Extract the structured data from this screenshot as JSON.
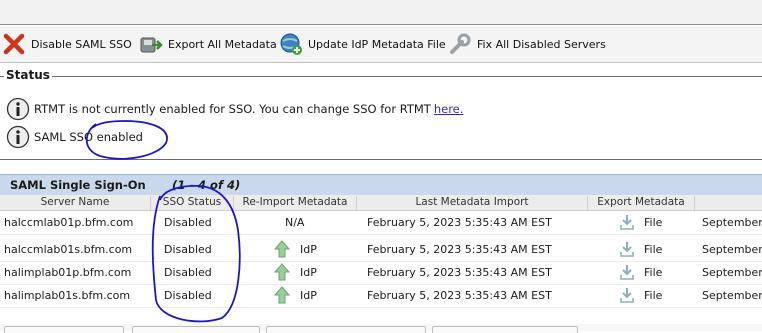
{
  "toolbar": {
    "disable_sso": "Disable SAML SSO",
    "export_all": "Export All Metadata",
    "update_idp": "Update IdP Metadata File",
    "fix_servers": "Fix All Disabled Servers"
  },
  "status": {
    "legend": "Status",
    "rtmt_message": "RTMT is not currently enabled for SSO. You can change SSO for RTMT",
    "rtmt_link": "here.",
    "saml_message": "SAML SSO enabled"
  },
  "grid": {
    "title": "SAML Single Sign-On",
    "count": "(1 - 4 of 4)",
    "columns": [
      "Server Name",
      "SSO Status",
      "Re-Import Metadata",
      "Last Metadata Import",
      "Export Metadata"
    ],
    "rows": [
      {
        "server": "halccmlab01p.bfm.com",
        "status": "Disabled",
        "reimport": "N/A",
        "last_import": "February 5, 2023 5:35:43 AM EST",
        "export": "File",
        "extra": "September"
      },
      {
        "server": "halccmlab01s.bfm.com",
        "status": "Disabled",
        "reimport": "IdP",
        "last_import": "February 5, 2023 5:35:43 AM EST",
        "export": "File",
        "extra": "September"
      },
      {
        "server": "halimplab01p.bfm.com",
        "status": "Disabled",
        "reimport": "IdP",
        "last_import": "February 5, 2023 5:35:43 AM EST",
        "export": "File",
        "extra": "September"
      },
      {
        "server": "halimplab01s.bfm.com",
        "status": "Disabled",
        "reimport": "IdP",
        "last_import": "February 5, 2023 5:35:43 AM EST",
        "export": "File",
        "extra": "September"
      }
    ]
  },
  "colors": {
    "annotation": "#1b16c9",
    "header_bar": "#c9d8ea",
    "link": "#3b2aa8"
  }
}
